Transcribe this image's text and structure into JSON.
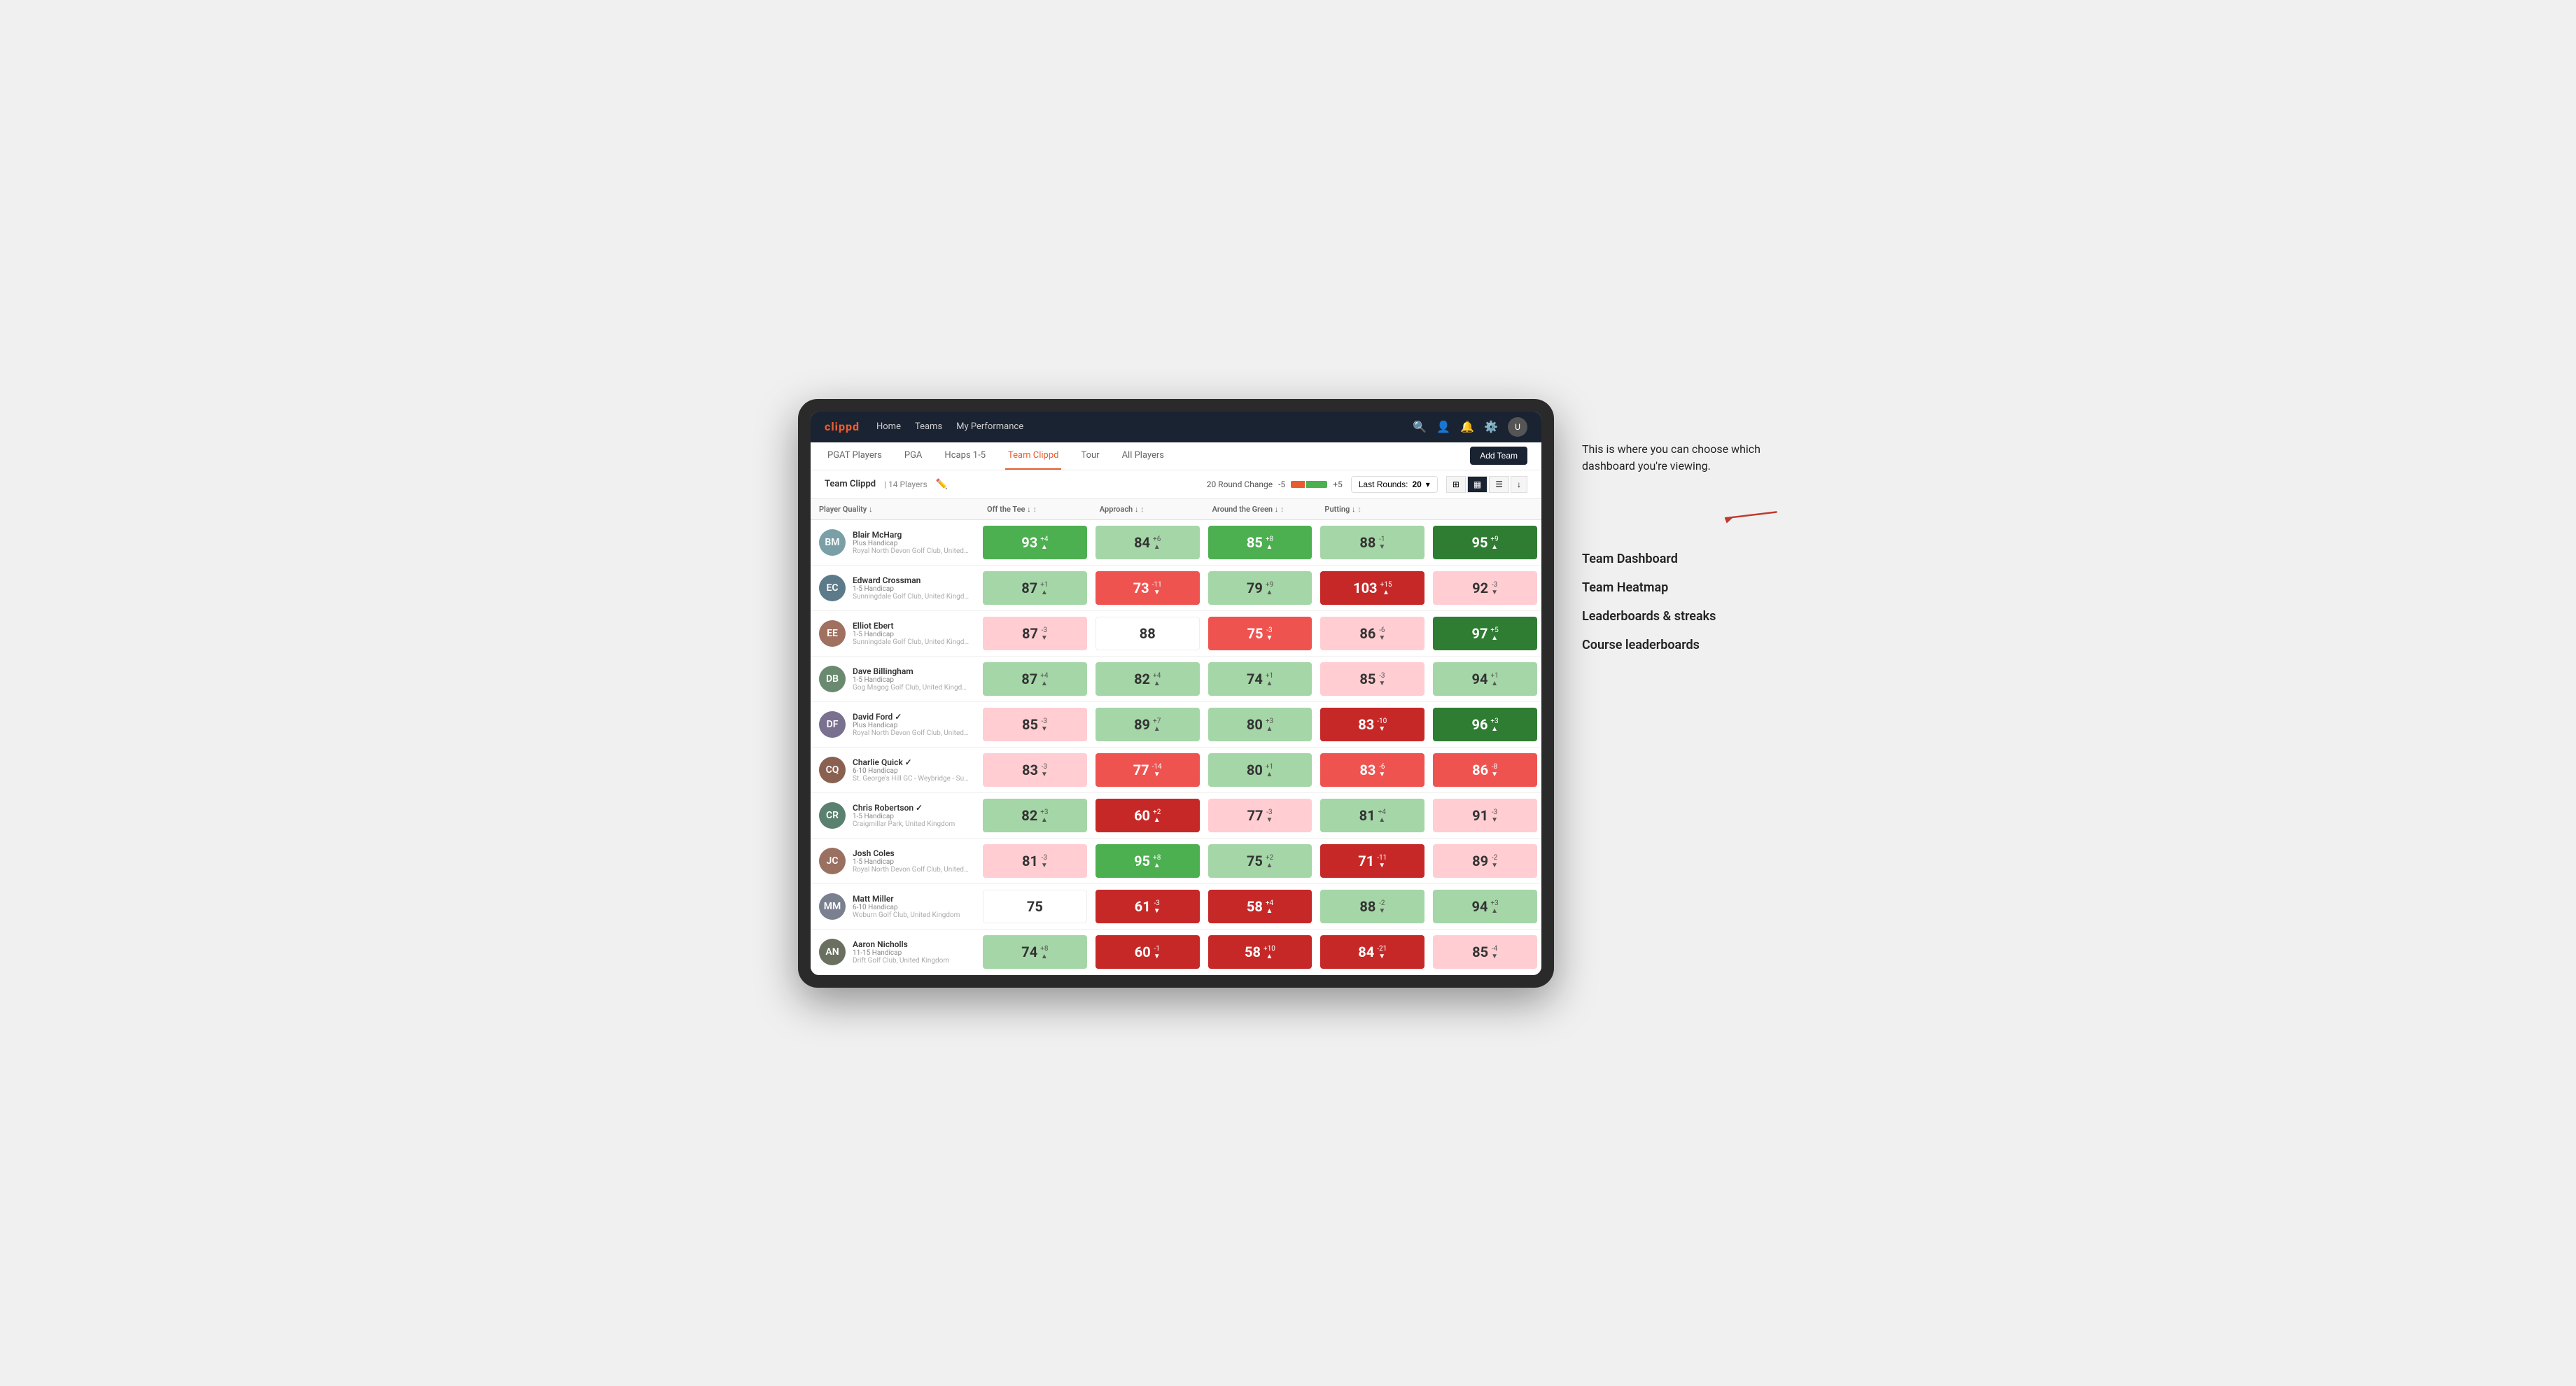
{
  "annotation": {
    "intro_text": "This is where you can choose which dashboard you're viewing.",
    "options": [
      "Team Dashboard",
      "Team Heatmap",
      "Leaderboards & streaks",
      "Course leaderboards"
    ]
  },
  "nav": {
    "logo": "clippd",
    "links": [
      "Home",
      "Teams",
      "My Performance"
    ],
    "icons": [
      "search",
      "user",
      "bell",
      "settings",
      "avatar"
    ]
  },
  "sub_nav": {
    "items": [
      "PGAT Players",
      "PGA",
      "Hcaps 1-5",
      "Team Clippd",
      "Tour",
      "All Players"
    ],
    "active": "Team Clippd",
    "add_button": "Add Team"
  },
  "team_header": {
    "name": "Team Clippd",
    "separator": "|",
    "count": "14 Players",
    "round_change_label": "20 Round Change",
    "change_minus": "-5",
    "change_plus": "+5",
    "last_rounds_label": "Last Rounds:",
    "last_rounds_value": "20"
  },
  "table": {
    "columns": [
      "Player Quality ↓",
      "Off the Tee ↓",
      "Approach ↓",
      "Around the Green ↓",
      "Putting ↓"
    ],
    "rows": [
      {
        "name": "Blair McHarg",
        "initials": "BM",
        "handicap": "Plus Handicap",
        "club": "Royal North Devon Golf Club, United Kingdom",
        "scores": [
          {
            "value": 93,
            "change": "+4",
            "dir": "up",
            "bg": "bg-green-mid"
          },
          {
            "value": 84,
            "change": "+6",
            "dir": "up",
            "bg": "bg-green-light",
            "dark": true
          },
          {
            "value": 85,
            "change": "+8",
            "dir": "up",
            "bg": "bg-green-mid"
          },
          {
            "value": 88,
            "change": "-1",
            "dir": "down",
            "bg": "bg-green-light",
            "dark": true
          },
          {
            "value": 95,
            "change": "+9",
            "dir": "up",
            "bg": "bg-green-strong"
          }
        ]
      },
      {
        "name": "Edward Crossman",
        "initials": "EC",
        "handicap": "1-5 Handicap",
        "club": "Sunningdale Golf Club, United Kingdom",
        "scores": [
          {
            "value": 87,
            "change": "+1",
            "dir": "up",
            "bg": "bg-green-light",
            "dark": true
          },
          {
            "value": 73,
            "change": "-11",
            "dir": "down",
            "bg": "bg-red-mid"
          },
          {
            "value": 79,
            "change": "+9",
            "dir": "up",
            "bg": "bg-green-light",
            "dark": true
          },
          {
            "value": 103,
            "change": "+15",
            "dir": "up",
            "bg": "bg-red-strong"
          },
          {
            "value": 92,
            "change": "-3",
            "dir": "down",
            "bg": "bg-red-light",
            "dark": true
          }
        ]
      },
      {
        "name": "Elliot Ebert",
        "initials": "EE",
        "handicap": "1-5 Handicap",
        "club": "Sunningdale Golf Club, United Kingdom",
        "scores": [
          {
            "value": 87,
            "change": "-3",
            "dir": "down",
            "bg": "bg-red-light",
            "dark": true
          },
          {
            "value": 88,
            "change": "",
            "dir": "",
            "bg": "bg-white",
            "dark": true
          },
          {
            "value": 75,
            "change": "-3",
            "dir": "down",
            "bg": "bg-red-mid"
          },
          {
            "value": 86,
            "change": "-6",
            "dir": "down",
            "bg": "bg-red-light",
            "dark": true
          },
          {
            "value": 97,
            "change": "+5",
            "dir": "up",
            "bg": "bg-green-strong"
          }
        ]
      },
      {
        "name": "Dave Billingham",
        "initials": "DB",
        "handicap": "1-5 Handicap",
        "club": "Gog Magog Golf Club, United Kingdom",
        "scores": [
          {
            "value": 87,
            "change": "+4",
            "dir": "up",
            "bg": "bg-green-light",
            "dark": true
          },
          {
            "value": 82,
            "change": "+4",
            "dir": "up",
            "bg": "bg-green-light",
            "dark": true
          },
          {
            "value": 74,
            "change": "+1",
            "dir": "up",
            "bg": "bg-green-light",
            "dark": true
          },
          {
            "value": 85,
            "change": "-3",
            "dir": "down",
            "bg": "bg-red-light",
            "dark": true
          },
          {
            "value": 94,
            "change": "+1",
            "dir": "up",
            "bg": "bg-green-light",
            "dark": true
          }
        ]
      },
      {
        "name": "David Ford",
        "initials": "DF",
        "handicap": "Plus Handicap",
        "club": "Royal North Devon Golf Club, United Kingdom",
        "verified": true,
        "scores": [
          {
            "value": 85,
            "change": "-3",
            "dir": "down",
            "bg": "bg-red-light",
            "dark": true
          },
          {
            "value": 89,
            "change": "+7",
            "dir": "up",
            "bg": "bg-green-light",
            "dark": true
          },
          {
            "value": 80,
            "change": "+3",
            "dir": "up",
            "bg": "bg-green-light",
            "dark": true
          },
          {
            "value": 83,
            "change": "-10",
            "dir": "down",
            "bg": "bg-red-strong"
          },
          {
            "value": 96,
            "change": "+3",
            "dir": "up",
            "bg": "bg-green-strong"
          }
        ]
      },
      {
        "name": "Charlie Quick",
        "initials": "CQ",
        "handicap": "6-10 Handicap",
        "club": "St. George's Hill GC - Weybridge - Surrey, Uni...",
        "verified": true,
        "scores": [
          {
            "value": 83,
            "change": "-3",
            "dir": "down",
            "bg": "bg-red-light",
            "dark": true
          },
          {
            "value": 77,
            "change": "-14",
            "dir": "down",
            "bg": "bg-red-mid"
          },
          {
            "value": 80,
            "change": "+1",
            "dir": "up",
            "bg": "bg-green-light",
            "dark": true
          },
          {
            "value": 83,
            "change": "-6",
            "dir": "down",
            "bg": "bg-red-mid"
          },
          {
            "value": 86,
            "change": "-8",
            "dir": "down",
            "bg": "bg-red-mid"
          }
        ]
      },
      {
        "name": "Chris Robertson",
        "initials": "CR",
        "handicap": "1-5 Handicap",
        "club": "Craigmillar Park, United Kingdom",
        "verified": true,
        "scores": [
          {
            "value": 82,
            "change": "+3",
            "dir": "up",
            "bg": "bg-green-light",
            "dark": true
          },
          {
            "value": 60,
            "change": "+2",
            "dir": "up",
            "bg": "bg-red-strong"
          },
          {
            "value": 77,
            "change": "-3",
            "dir": "down",
            "bg": "bg-red-light",
            "dark": true
          },
          {
            "value": 81,
            "change": "+4",
            "dir": "up",
            "bg": "bg-green-light",
            "dark": true
          },
          {
            "value": 91,
            "change": "-3",
            "dir": "down",
            "bg": "bg-red-light",
            "dark": true
          }
        ]
      },
      {
        "name": "Josh Coles",
        "initials": "JC",
        "handicap": "1-5 Handicap",
        "club": "Royal North Devon Golf Club, United Kingdom",
        "scores": [
          {
            "value": 81,
            "change": "-3",
            "dir": "down",
            "bg": "bg-red-light",
            "dark": true
          },
          {
            "value": 95,
            "change": "+8",
            "dir": "up",
            "bg": "bg-green-mid"
          },
          {
            "value": 75,
            "change": "+2",
            "dir": "up",
            "bg": "bg-green-light",
            "dark": true
          },
          {
            "value": 71,
            "change": "-11",
            "dir": "down",
            "bg": "bg-red-strong"
          },
          {
            "value": 89,
            "change": "-2",
            "dir": "down",
            "bg": "bg-red-light",
            "dark": true
          }
        ]
      },
      {
        "name": "Matt Miller",
        "initials": "MM",
        "handicap": "6-10 Handicap",
        "club": "Woburn Golf Club, United Kingdom",
        "scores": [
          {
            "value": 75,
            "change": "",
            "dir": "",
            "bg": "bg-white",
            "dark": true
          },
          {
            "value": 61,
            "change": "-3",
            "dir": "down",
            "bg": "bg-red-strong"
          },
          {
            "value": 58,
            "change": "+4",
            "dir": "up",
            "bg": "bg-red-strong"
          },
          {
            "value": 88,
            "change": "-2",
            "dir": "down",
            "bg": "bg-green-light",
            "dark": true
          },
          {
            "value": 94,
            "change": "+3",
            "dir": "up",
            "bg": "bg-green-light",
            "dark": true
          }
        ]
      },
      {
        "name": "Aaron Nicholls",
        "initials": "AN",
        "handicap": "11-15 Handicap",
        "club": "Drift Golf Club, United Kingdom",
        "scores": [
          {
            "value": 74,
            "change": "+8",
            "dir": "up",
            "bg": "bg-green-light",
            "dark": true
          },
          {
            "value": 60,
            "change": "-1",
            "dir": "down",
            "bg": "bg-red-strong"
          },
          {
            "value": 58,
            "change": "+10",
            "dir": "up",
            "bg": "bg-red-strong"
          },
          {
            "value": 84,
            "change": "-21",
            "dir": "down",
            "bg": "bg-red-strong"
          },
          {
            "value": 85,
            "change": "-4",
            "dir": "down",
            "bg": "bg-red-light",
            "dark": true
          }
        ]
      }
    ]
  },
  "avatar_colors": [
    "#7b9fa6",
    "#5c7a8a",
    "#a07060",
    "#6a8a70",
    "#7a7090",
    "#8a6050",
    "#5a8070",
    "#9a7060",
    "#7a8090",
    "#6a7060"
  ]
}
